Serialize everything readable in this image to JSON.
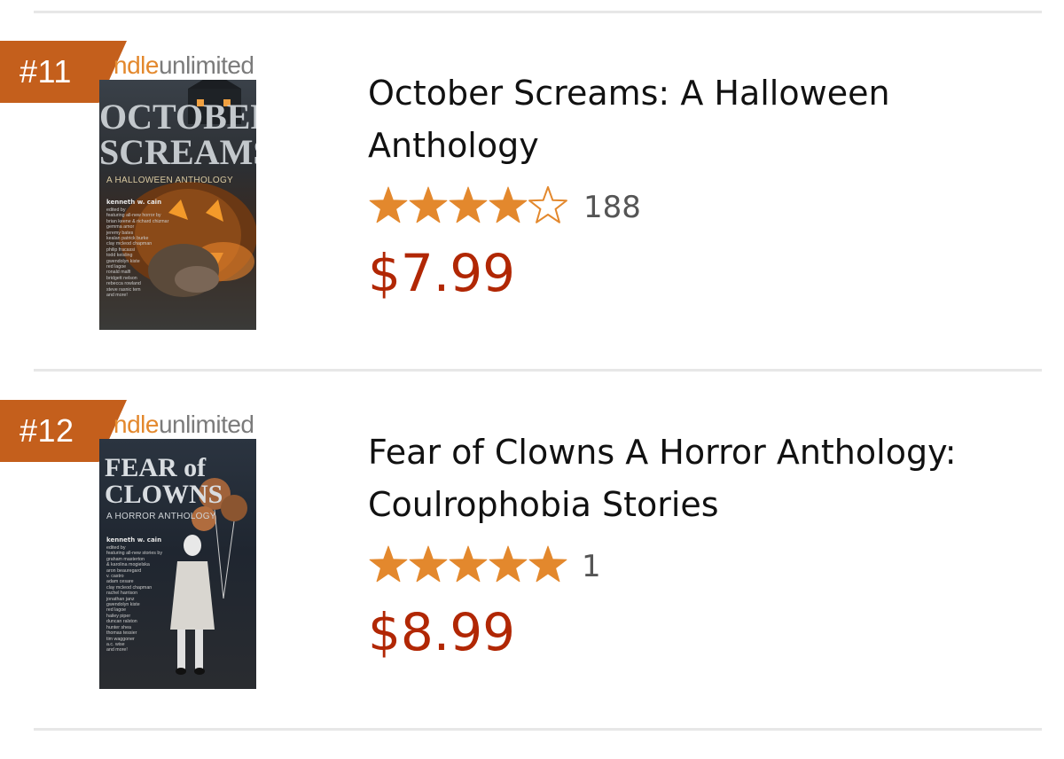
{
  "items": [
    {
      "rank": "#11",
      "badge": {
        "kindle": "ndle",
        "unlimited": "unlimited"
      },
      "cover": {
        "title_line1": "OCTOBER",
        "title_line2": "SCREAMS",
        "subtitle": "A HALLOWEEN ANTHOLOGY",
        "editor": "kenneth w. cain",
        "credits": "edited by\nfeaturing all-new horror by\nbrian keene & richard chizmar\ngemma amor\njeremy bates\nkealan patrick burke\nclay mcleod chapman\nphilip fracassi\ntodd keisling\ngwendolyn kiste\nred lagoe\nronald malfi\nbridgett nelson\nrebecca rowland\nsteve rasnic tem\nand more!"
      },
      "title": "October Screams: A Halloween Anthology",
      "rating": 4,
      "rating_max": 5,
      "review_count": "188",
      "price": "$7.99"
    },
    {
      "rank": "#12",
      "badge": {
        "kindle": "ndle",
        "unlimited": "unlimited"
      },
      "cover": {
        "title_line1": "FEAR of",
        "title_line2": "CLOWNS",
        "subtitle": "A HORROR ANTHOLOGY",
        "editor": "kenneth w. cain",
        "credits": "edited by\nfeaturing all-new stories by\ngraham masterton\n& karolina mogielska\naron beauregard\nv. castro\nadam cesare\nclay mcleod chapman\nrachel harrison\njonathan janz\ngwendolyn kiste\nred lagoe\nhailey piper\nduncan ralston\nhunter shea\nthomas tessier\ntim waggoner\na.c. wise\nand more!"
      },
      "title": "Fear of Clowns A Horror Anthology: Coulrophobia Stories",
      "rating": 5,
      "rating_max": 5,
      "review_count": "1",
      "price": "$8.99"
    }
  ],
  "colors": {
    "rank_badge": "#c45f1c",
    "star_fill": "#e3882d",
    "price": "#b12704",
    "divider": "#e7e7e7",
    "kindle_orange": "#e3882d"
  },
  "icons": {
    "star_full": "star-full-icon",
    "star_empty": "star-empty-icon"
  }
}
